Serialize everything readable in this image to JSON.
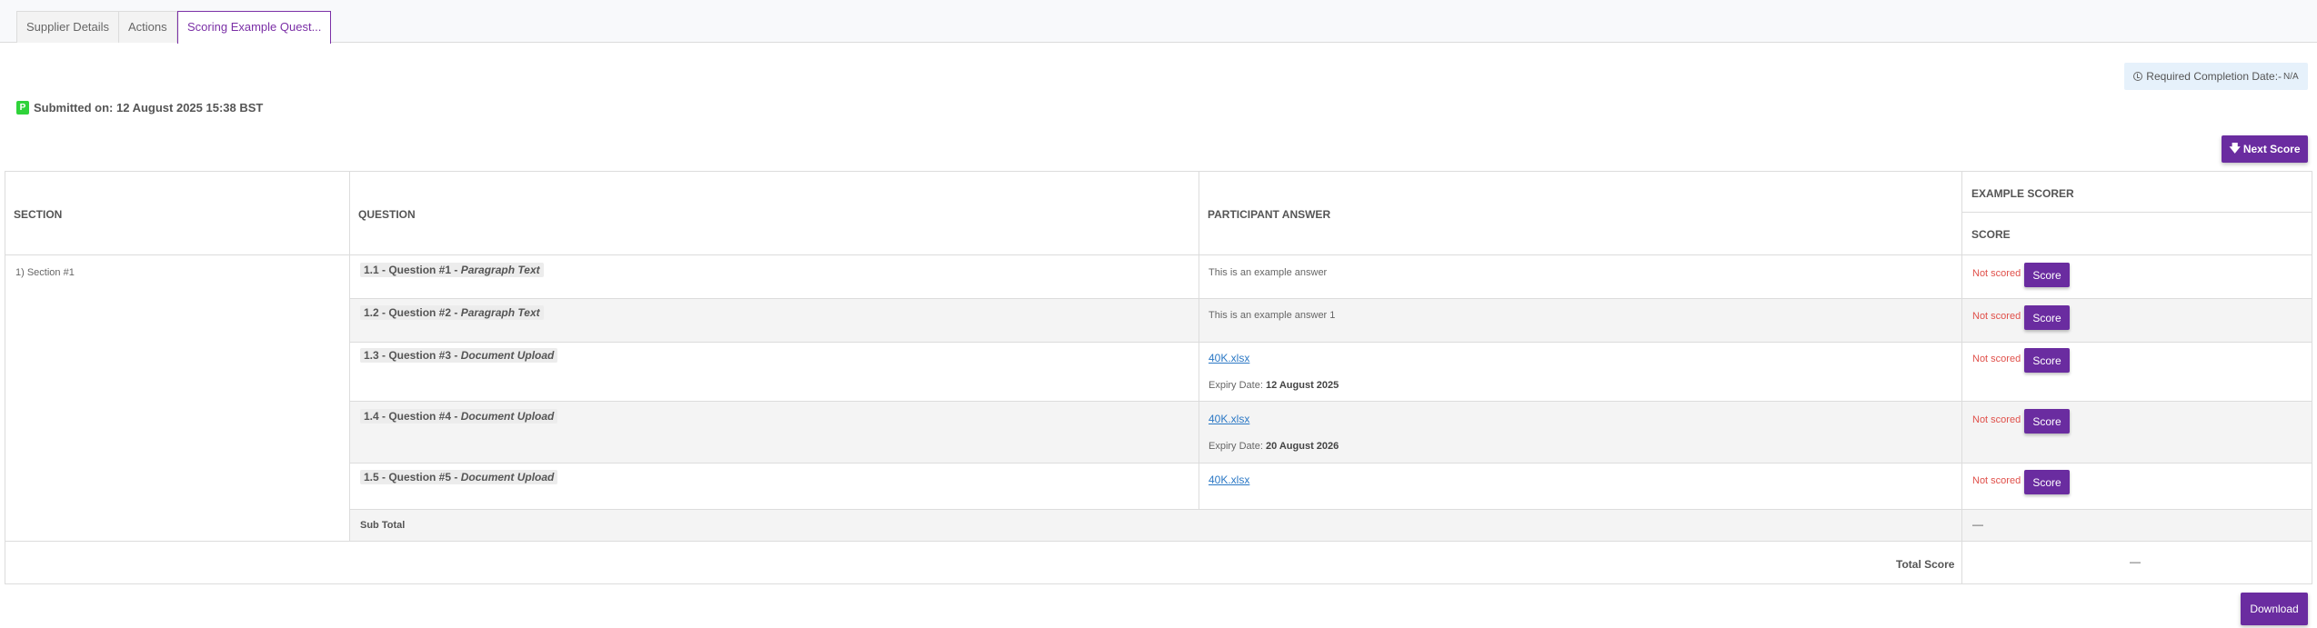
{
  "tabs": [
    {
      "label": "Supplier Details",
      "active": false
    },
    {
      "label": "Actions",
      "active": false
    },
    {
      "label": "Scoring Example Quest...",
      "active": true
    }
  ],
  "required_completion": {
    "label": "Required Completion Date:-",
    "value": "N/A"
  },
  "submission": {
    "icon_letter": "P",
    "text": "Submitted on: 12 August 2025 15:38 BST"
  },
  "next_score_label": "Next Score",
  "table": {
    "headers": {
      "section": "SECTION",
      "question": "QUESTION",
      "answer": "PARTICIPANT ANSWER",
      "scorer": "EXAMPLE SCORER",
      "score": "SCORE"
    },
    "section_name": "1) Section #1",
    "rows": [
      {
        "question": "1.1 - Question #1 - ",
        "type": "Paragraph Text",
        "answer": "This is an example answer",
        "status": "Not scored",
        "action": "Score"
      },
      {
        "question": "1.2 - Question #2 - ",
        "type": "Paragraph Text",
        "answer": "This is an example answer 1",
        "status": "Not scored",
        "action": "Score"
      },
      {
        "question": "1.3 - Question #3 - ",
        "type": "Document Upload",
        "file": "40K.xlsx",
        "expiry_label": "Expiry Date: ",
        "expiry_value": "12 August 2025",
        "status": "Not scored",
        "action": "Score"
      },
      {
        "question": "1.4 - Question #4 - ",
        "type": "Document Upload",
        "file": "40K.xlsx",
        "expiry_label": "Expiry Date: ",
        "expiry_value": "20 August 2026",
        "status": "Not scored",
        "action": "Score"
      },
      {
        "question": "1.5 - Question #5 - ",
        "type": "Document Upload",
        "file": "40K.xlsx",
        "status": "Not scored",
        "action": "Score"
      }
    ],
    "subtotal_label": "Sub Total",
    "subtotal_value": "—",
    "total_label": "Total Score",
    "total_value": "—"
  },
  "download_label": "Download",
  "colors": {
    "accent": "#6a2ca0",
    "not_scored": "#e0504a",
    "link": "#2b78c5",
    "submitted_badge": "#2fd33a"
  }
}
